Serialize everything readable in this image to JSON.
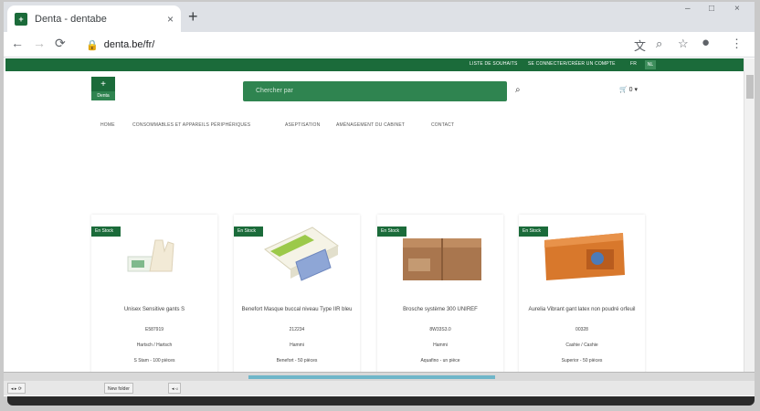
{
  "browser": {
    "tab_title": "Denta - dentabe",
    "tab_close": "×",
    "new_tab": "+",
    "url": "denta.be/fr/",
    "window_controls": [
      "–",
      "□",
      "×"
    ]
  },
  "topbar": {
    "links": [
      "LISTE DE SOUHAITS",
      "SE CONNECTER/CRÉER UN COMPTE",
      "FR",
      "NL"
    ]
  },
  "header": {
    "logo_text": "+",
    "logo_sub": "Denta",
    "search_placeholder": "Chercher par",
    "cart_label": "0 ▾"
  },
  "menu": {
    "items": [
      "HOME",
      "CONSOMMABLES ET APPAREILS PÉRIPHÉRIQUES",
      "ASEPTISATION",
      "AMÉNAGEMENT DU CABINET",
      "CONTACT"
    ]
  },
  "products": [
    {
      "badge": "En Stock",
      "name": "Unisex Sensitive gants S",
      "ref": "E587919",
      "brand": "Hartsch / Hartsch",
      "pack": "S Stam - 100 pièces"
    },
    {
      "badge": "En Stock",
      "name": "Benefort Masque buccal niveau Type IIR bleu",
      "ref": "212234",
      "brand": "Hammi",
      "pack": "Benefort - 50 pièces"
    },
    {
      "badge": "En Stock",
      "name": "Brosche système 300 UNIREF",
      "ref": "8W33S3.0",
      "brand": "Hammi",
      "pack": "Aquafino - un pièce"
    },
    {
      "badge": "En Stock",
      "name": "Aurelia Vibrant gant latex non poudré orfeuil",
      "ref": "00328",
      "brand": "Cashie / Cashie",
      "pack": "Superior - 50 pièces"
    }
  ],
  "taskbar": {
    "items": [
      "◂ ▸ ⟳",
      "New folder",
      "◂ ◃"
    ]
  }
}
